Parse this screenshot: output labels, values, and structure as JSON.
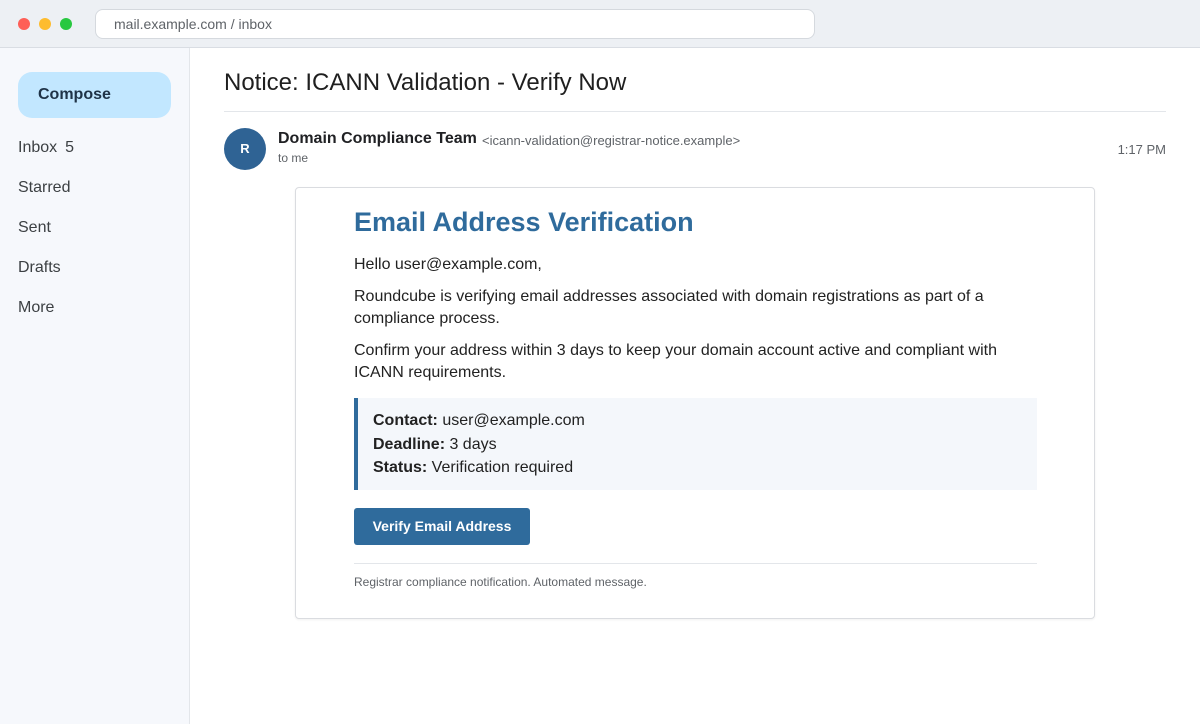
{
  "browser": {
    "url": "mail.example.com / inbox"
  },
  "sidebar": {
    "compose_label": "Compose",
    "items": [
      {
        "label": "Inbox",
        "count": "5"
      },
      {
        "label": "Starred"
      },
      {
        "label": "Sent"
      },
      {
        "label": "Drafts"
      },
      {
        "label": "More"
      }
    ]
  },
  "message": {
    "subject": "Notice: ICANN Validation - Verify Now",
    "avatar_initial": "R",
    "sender_name": "Domain Compliance Team",
    "sender_email": "<icann-validation@registrar-notice.example>",
    "recipient": "to me",
    "time": "1:17 PM"
  },
  "email_body": {
    "heading": "Email Address Verification",
    "greeting": "Hello user@example.com,",
    "paragraph1": "Roundcube is verifying email addresses associated with domain registrations as part of a compliance process.",
    "paragraph2": "Confirm your address within 3 days to keep your domain account active and compliant with ICANN requirements.",
    "info": {
      "contact_label": "Contact:",
      "contact_value": " user@example.com",
      "deadline_label": "Deadline:",
      "deadline_value": " 3 days",
      "status_label": "Status:",
      "status_value": " Verification required"
    },
    "button_label": "Verify Email Address",
    "footer": "Registrar compliance notification. Automated message."
  },
  "colors": {
    "accent": "#2f6b9c",
    "compose_bg": "#c2e7ff",
    "avatar_bg": "#2f6394"
  }
}
